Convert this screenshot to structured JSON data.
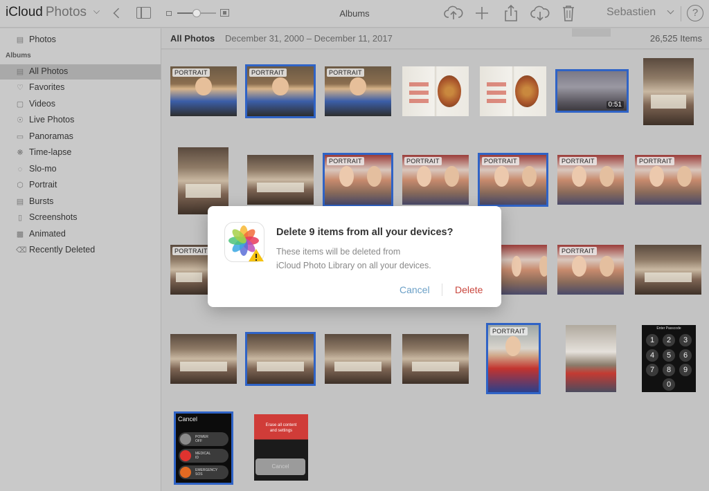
{
  "toolbar": {
    "brand_bold": "iCloud",
    "brand_light": "Photos",
    "title": "Albums",
    "zoom_level": 0.5,
    "user_name": "Sebastien",
    "help_label": "?"
  },
  "sidebar": {
    "top_item": "Photos",
    "section_label": "Albums",
    "items": [
      {
        "label": "All Photos",
        "icon": "photos-stack-icon",
        "active": true
      },
      {
        "label": "Favorites",
        "icon": "heart-icon"
      },
      {
        "label": "Videos",
        "icon": "video-camera-icon"
      },
      {
        "label": "Live Photos",
        "icon": "live-photo-icon"
      },
      {
        "label": "Panoramas",
        "icon": "panorama-icon"
      },
      {
        "label": "Time-lapse",
        "icon": "time-lapse-icon"
      },
      {
        "label": "Slo-mo",
        "icon": "slo-mo-icon"
      },
      {
        "label": "Portrait",
        "icon": "portrait-cube-icon"
      },
      {
        "label": "Bursts",
        "icon": "bursts-icon"
      },
      {
        "label": "Screenshots",
        "icon": "screenshot-phone-icon"
      },
      {
        "label": "Animated",
        "icon": "animated-icon"
      },
      {
        "label": "Recently Deleted",
        "icon": "trash-icon"
      }
    ]
  },
  "main": {
    "title": "All Photos",
    "date_range": "December 31, 2000 – December 11, 2017",
    "item_count": "26,525 Items",
    "badge_portrait": "PORTRAIT",
    "video_duration": "0:51",
    "keypad": {
      "title": "Enter Passcode",
      "keys": [
        "1",
        "2",
        "3",
        "4",
        "5",
        "6",
        "7",
        "8",
        "9",
        "0"
      ]
    },
    "watch": {
      "cancel": "Cancel",
      "rows": [
        {
          "line1": "POWER",
          "line2": "OFF",
          "color": "#8a8a8a"
        },
        {
          "line1": "MEDICAL",
          "line2": "ID",
          "color": "#e0332f"
        },
        {
          "line1": "EMERGENCY",
          "line2": "SOS",
          "color": "#e36a22",
          "dot": "SOS"
        }
      ]
    },
    "erase": {
      "line1": "Erase all content",
      "line2": "and settings",
      "button": "Cancel"
    }
  },
  "dialog": {
    "title": "Delete 9 items from all your devices?",
    "body_line1": "These items will be deleted from",
    "body_line2": "iCloud Photo Library on all your devices.",
    "cancel_label": "Cancel",
    "delete_label": "Delete",
    "cancel_color": "#6a9fc6",
    "delete_color": "#c9463d"
  },
  "colors": {
    "selection": "#2f63c6"
  }
}
